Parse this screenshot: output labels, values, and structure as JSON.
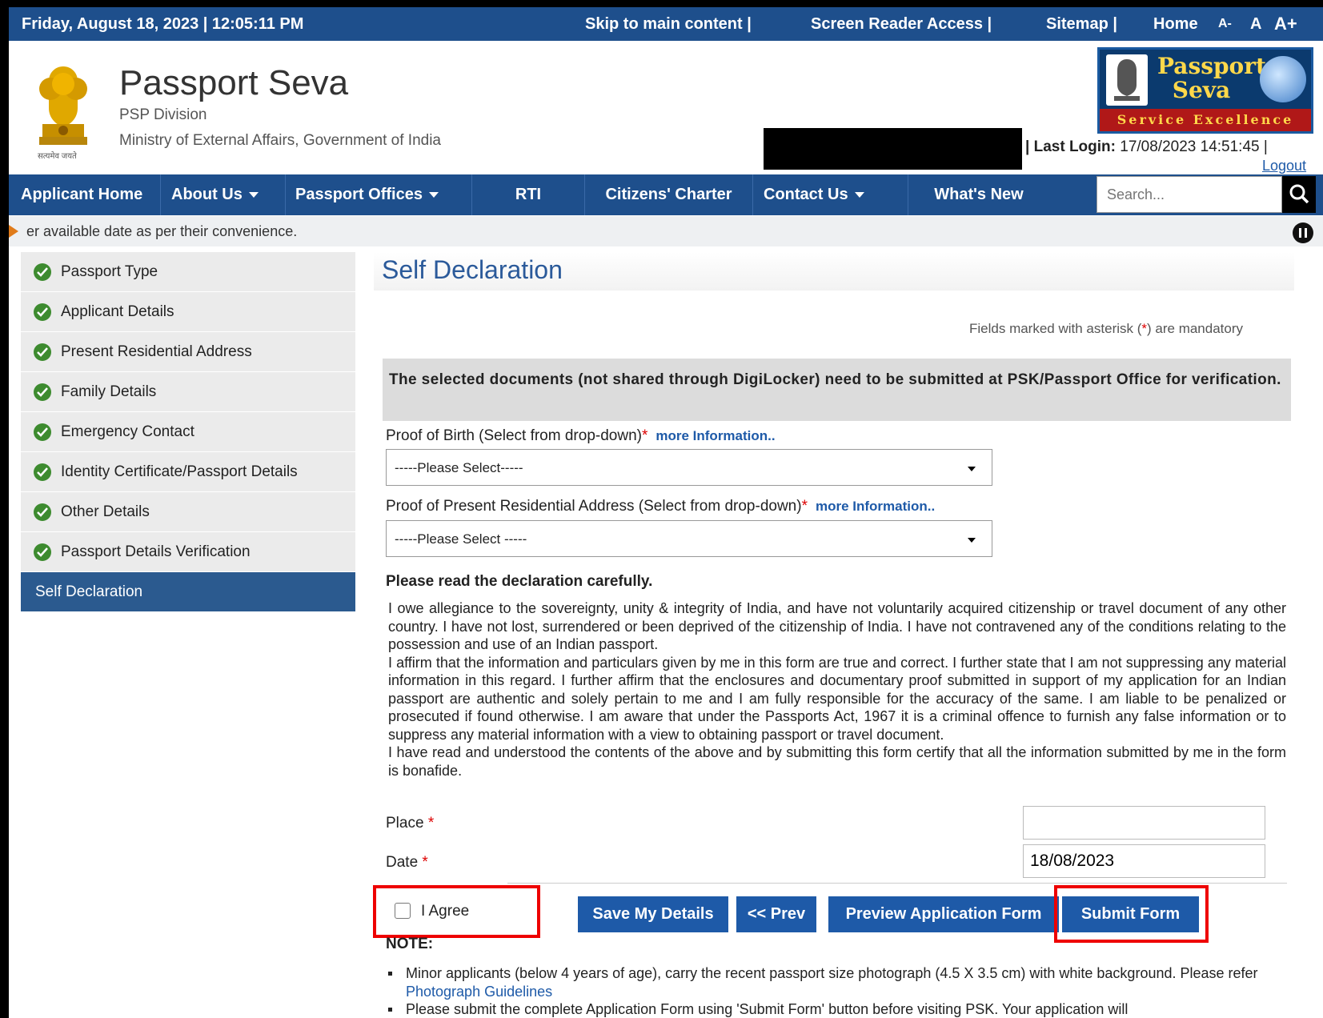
{
  "topbar": {
    "datetime": "Friday, August 18, 2023 | 12:05:11 PM",
    "skip": "Skip to main content |",
    "screen_reader": "Screen Reader Access |",
    "sitemap": "Sitemap |",
    "home": "Home",
    "font_small": "A-",
    "font_normal": "A",
    "font_large": "A+"
  },
  "header": {
    "title": "Passport Seva",
    "division": "PSP Division",
    "ministry": "Ministry of External Affairs, Government of India",
    "emblem_caption": "सत्यमेव जयते",
    "logo_line1": "Passport",
    "logo_line2": "Seva",
    "logo_tagline": "Service Excellence",
    "last_login_label": "| Last Login:",
    "last_login_value": "17/08/2023 14:51:45 |",
    "logout": "Logout"
  },
  "nav": {
    "items": [
      {
        "label": "Applicant Home"
      },
      {
        "label": "About Us"
      },
      {
        "label": "Passport Offices"
      },
      {
        "label": "RTI"
      },
      {
        "label": "Citizens' Charter"
      },
      {
        "label": "Contact Us"
      },
      {
        "label": "What's New"
      }
    ],
    "search_placeholder": "Search..."
  },
  "ticker": "er available date as per their convenience.",
  "sidebar": {
    "items": [
      {
        "label": "Passport Type"
      },
      {
        "label": "Applicant Details"
      },
      {
        "label": "Present Residential Address"
      },
      {
        "label": "Family Details"
      },
      {
        "label": "Emergency Contact"
      },
      {
        "label": "Identity Certificate/Passport Details"
      },
      {
        "label": "Other Details"
      },
      {
        "label": "Passport Details Verification"
      },
      {
        "label": "Self Declaration"
      }
    ]
  },
  "main": {
    "title": "Self Declaration",
    "mandatory_pre": "Fields marked with asterisk (",
    "mandatory_star": "*",
    "mandatory_post": ") are mandatory",
    "doc_notice": "The selected documents (not shared through DigiLocker) need to be submitted at PSK/Passport Office for verification.",
    "proof_birth_label": "Proof of Birth (Select from drop-down)",
    "proof_birth_value": "-----Please Select-----",
    "proof_address_label": "Proof of Present Residential Address (Select from drop-down)",
    "proof_address_value": "-----Please Select -----",
    "more_info": "more Information..",
    "required_star": "*",
    "declaration_heading": "Please read the declaration carefully.",
    "declaration_p1": "I owe allegiance to the sovereignty, unity & integrity of India, and have not voluntarily acquired citizenship or travel document of any other country. I have not lost, surrendered or been deprived of the citizenship of India. I have not contravened any of the conditions relating to the possession and use of an Indian passport.",
    "declaration_p2": "I affirm that the information and particulars given by me in this form are true and correct. I further state that I am not suppressing any material information in this regard. I further affirm that the enclosures and documentary proof submitted in support of my application for an Indian passport are authentic and solely pertain to me and I am fully responsible for the accuracy of the same. I am liable to be penalized or prosecuted if found otherwise. I am aware that under the Passports Act, 1967 it is a criminal offence to furnish any false information or to suppress any material information with a view to obtaining passport or travel document.",
    "declaration_p3": "I have read and understood the contents of the above and by submitting this form certify that all the information submitted by me in the form is bonafide.",
    "place_label": "Place",
    "place_value": "",
    "date_label": "Date",
    "date_value": "18/08/2023",
    "agree_label": "I Agree",
    "buttons": {
      "save": "Save My Details",
      "prev": "<< Prev",
      "preview": "Preview Application Form",
      "submit": "Submit Form"
    },
    "note_heading": "NOTE:",
    "note1": "Minor applicants (below 4 years of age), carry the recent passport size photograph (4.5 X 3.5 cm) with white background. Please refer",
    "note1_link": "Photograph Guidelines",
    "note2": "Please submit the complete Application Form using 'Submit Form' button before visiting PSK. Your application will"
  },
  "colors": {
    "primary": "#1e4f8c",
    "button": "#1e5aa8",
    "check_green": "#3d8b2f",
    "highlight_red": "#e00000"
  }
}
